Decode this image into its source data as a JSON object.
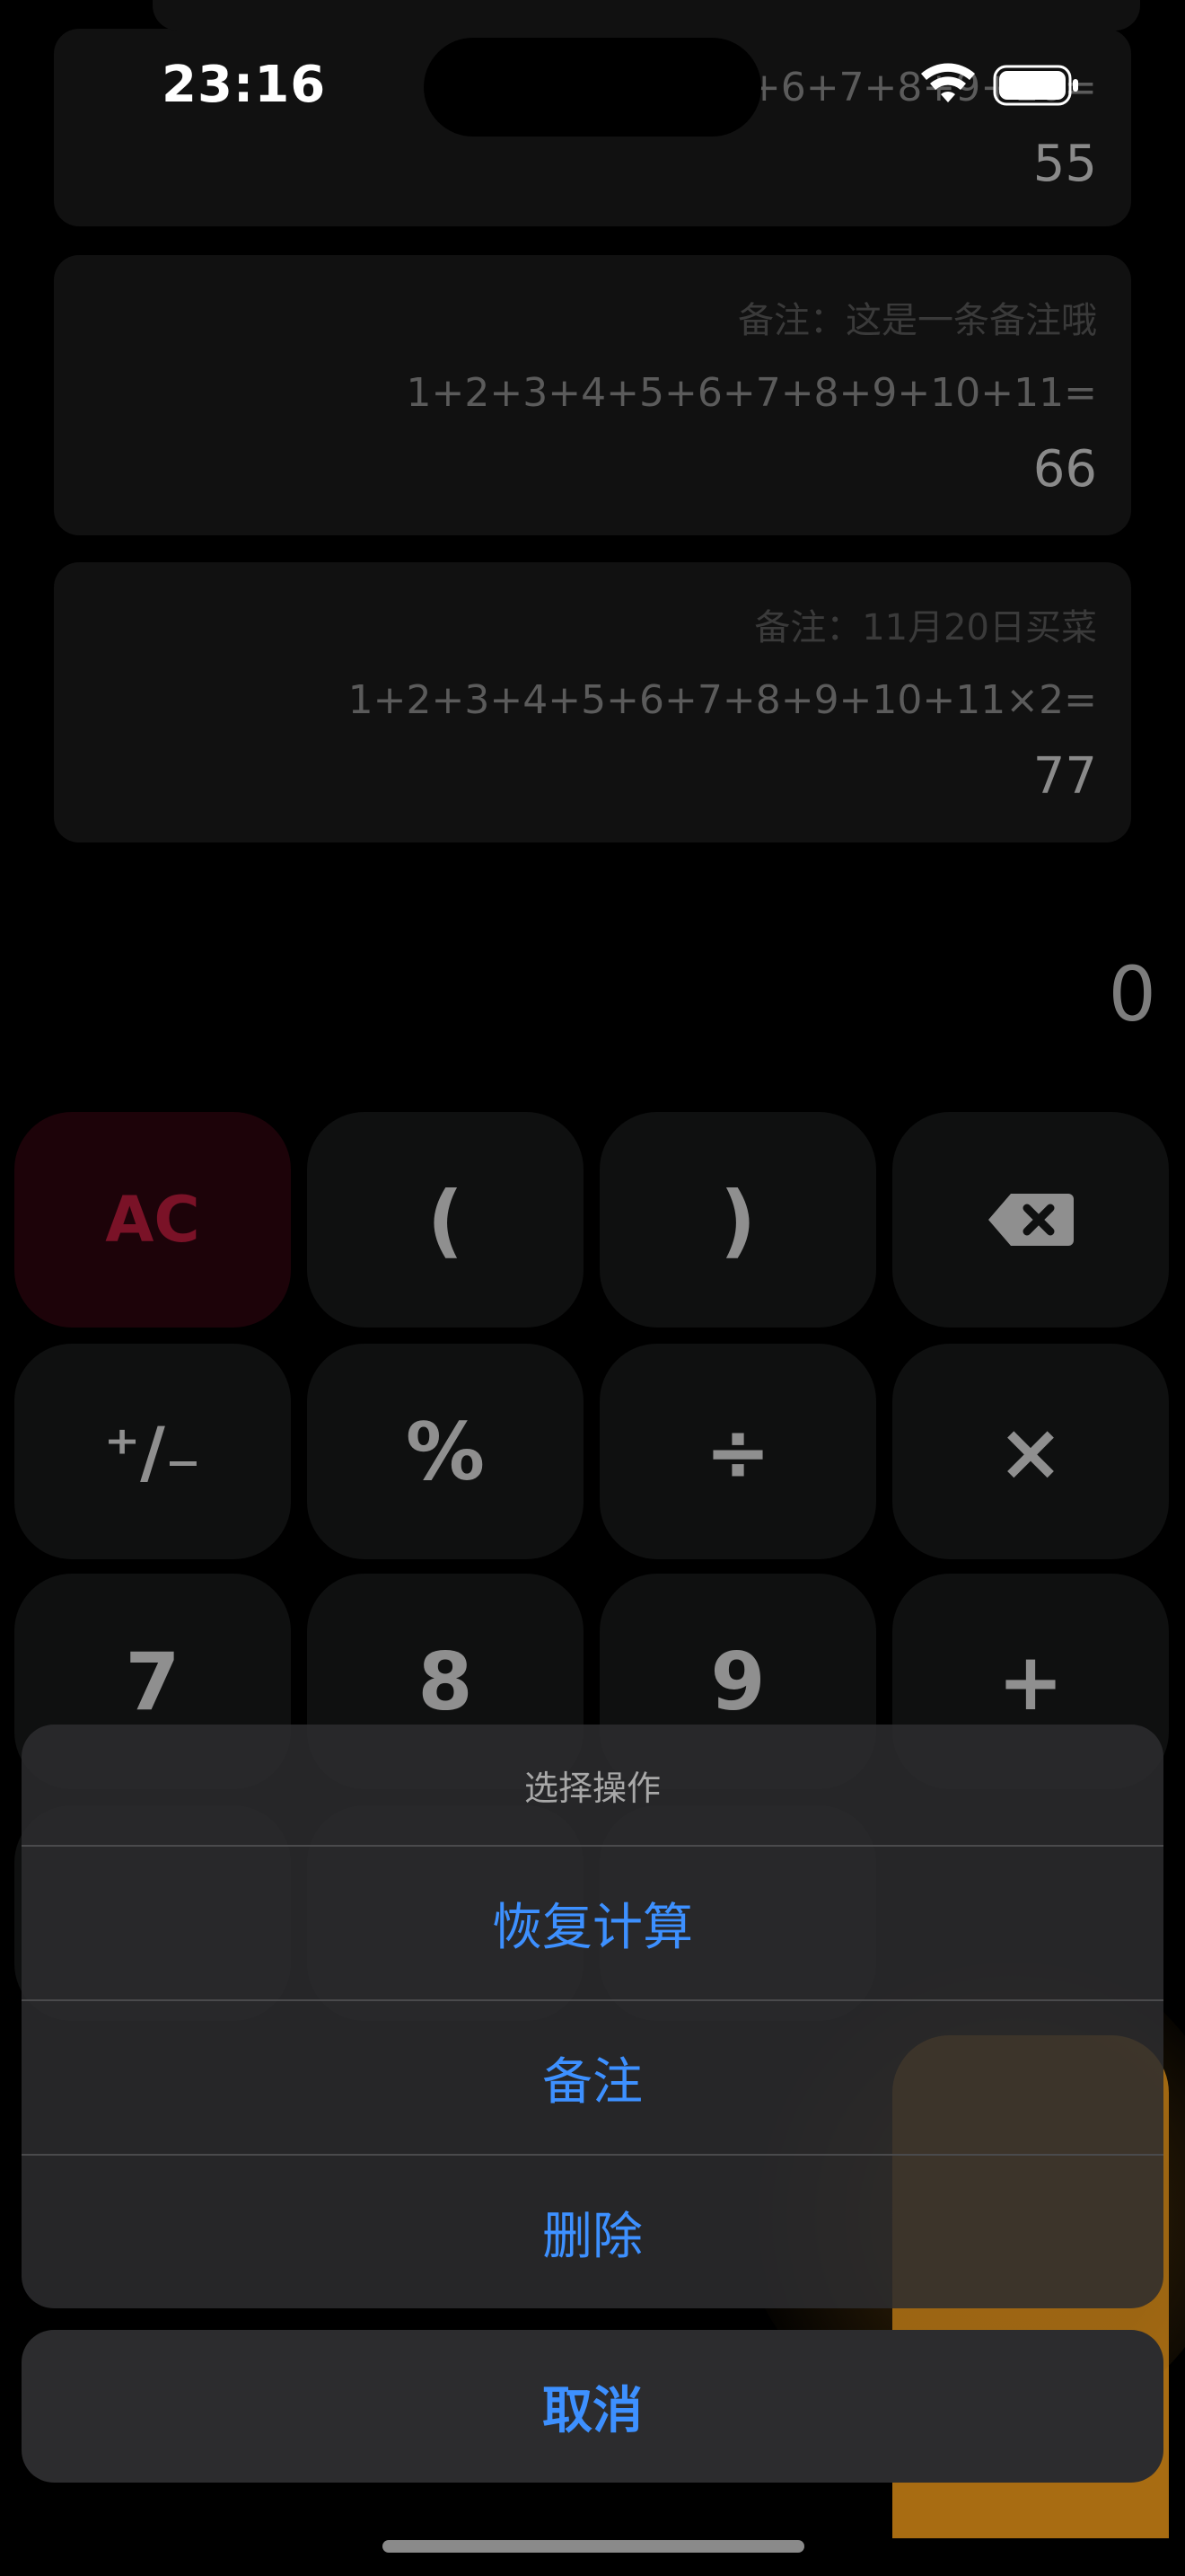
{
  "status_bar": {
    "time": "23:16",
    "wifi_icon": "wifi-icon",
    "battery_icon": "battery-icon"
  },
  "history": [
    {
      "expression": "1+2+3+4+5+6+7+8+9+10=",
      "result": "55"
    },
    {
      "note": "备注：这是一条备注哦",
      "expression": "1+2+3+4+5+6+7+8+9+10+11=",
      "result": "66"
    },
    {
      "note": "备注：11月20日买菜",
      "expression": "1+2+3+4+5+6+7+8+9+10+11×2=",
      "result": "77"
    }
  ],
  "display": {
    "value": "0"
  },
  "keypad": {
    "rows": [
      [
        "AC",
        "(",
        ")",
        "⌫"
      ],
      [
        "⁺∕₋",
        "%",
        "÷",
        "×"
      ],
      [
        "7",
        "8",
        "9",
        "+"
      ]
    ],
    "backspace_icon": "backspace-icon"
  },
  "action_sheet": {
    "title": "选择操作",
    "actions": [
      "恢复计算",
      "备注",
      "删除"
    ],
    "cancel": "取消"
  },
  "colors": {
    "accent_blue": "#3d90ff",
    "ac_red": "#7a1227",
    "orange": "#a86c12"
  }
}
